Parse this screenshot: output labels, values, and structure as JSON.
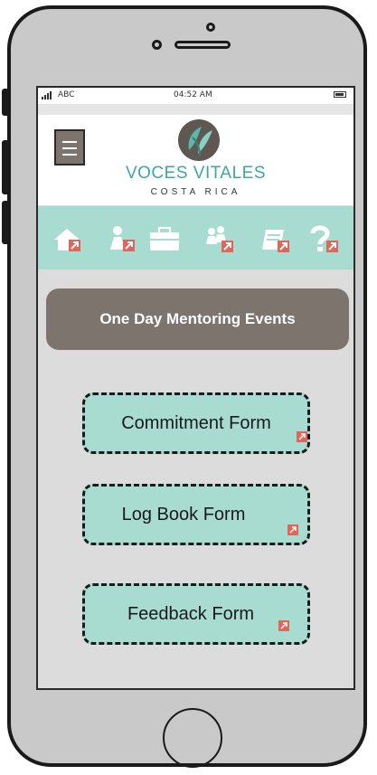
{
  "status": {
    "carrier": "ABC",
    "time": "04:52 AM"
  },
  "header": {
    "title": "VOCES VITALES",
    "subtitle": "COSTA RICA"
  },
  "nav_icons": [
    "home-icon",
    "person-icon",
    "briefcase-icon",
    "group-icon",
    "book-icon",
    "help-icon"
  ],
  "banner": {
    "title": "One Day Mentoring Events"
  },
  "forms": [
    {
      "label": "Commitment Form"
    },
    {
      "label": "Log Book Form"
    },
    {
      "label": "Feedback Form"
    }
  ],
  "colors": {
    "teal": "#a8dcd1",
    "taupe": "#7d746e",
    "accent": "#e0665c",
    "logo_teal": "#3fa7a2"
  }
}
